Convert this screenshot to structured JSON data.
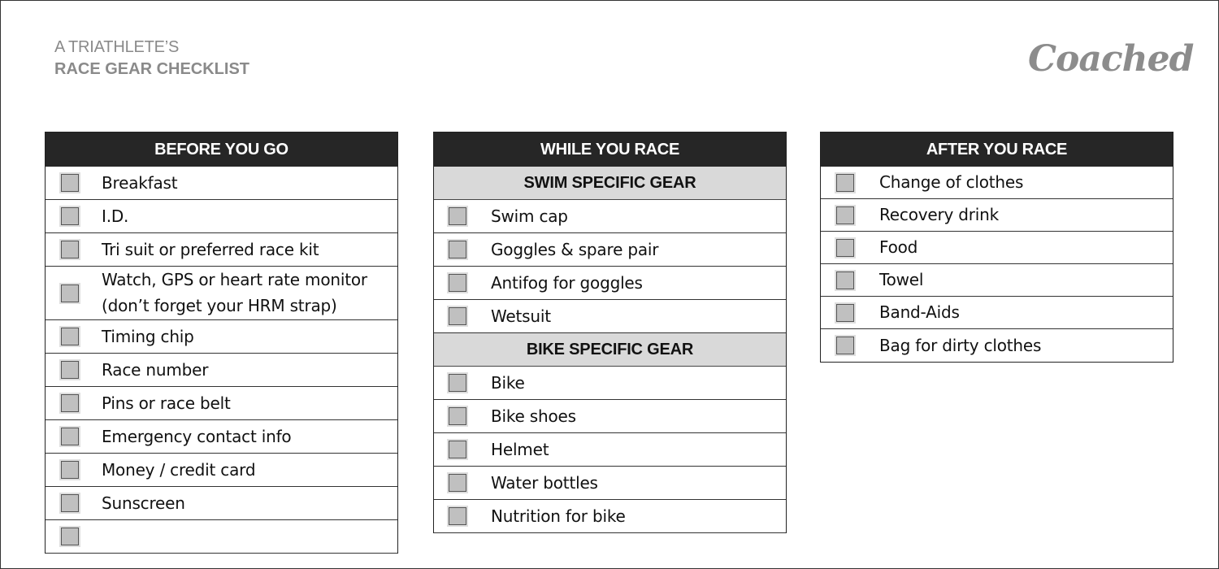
{
  "header": {
    "subtitle": "A TRIATHLETE’S",
    "title": "RACE GEAR CHECKLIST",
    "brand": "Coached"
  },
  "columns": [
    {
      "title": "BEFORE YOU GO",
      "items": [
        {
          "label": "Breakfast",
          "checked": false
        },
        {
          "label": "I.D.",
          "checked": false
        },
        {
          "label": "Tri suit or preferred race kit",
          "checked": false
        },
        {
          "label": "Watch, GPS or heart rate monitor",
          "label_line2": "(don’t forget your HRM strap)",
          "checked": false
        },
        {
          "label": "Timing chip",
          "checked": false
        },
        {
          "label": "Race number",
          "checked": false
        },
        {
          "label": "Pins or race belt",
          "checked": false
        },
        {
          "label": "Emergency contact info",
          "checked": false
        },
        {
          "label": "Money / credit card",
          "checked": false
        },
        {
          "label": "Sunscreen",
          "checked": false
        }
      ]
    },
    {
      "title": "WHILE YOU RACE",
      "sections": [
        {
          "title": "SWIM SPECIFIC GEAR",
          "items": [
            {
              "label": "Swim cap",
              "checked": false
            },
            {
              "label": "Goggles & spare pair",
              "checked": false
            },
            {
              "label": "Antifog for goggles",
              "checked": false
            },
            {
              "label": "Wetsuit",
              "checked": false
            }
          ]
        },
        {
          "title": "BIKE SPECIFIC GEAR",
          "items": [
            {
              "label": "Bike",
              "checked": false
            },
            {
              "label": "Bike shoes",
              "checked": false
            },
            {
              "label": "Helmet",
              "checked": false
            },
            {
              "label": "Water bottles",
              "checked": false
            },
            {
              "label": "Nutrition for bike",
              "checked": false
            }
          ]
        }
      ]
    },
    {
      "title": "AFTER YOU RACE",
      "items": [
        {
          "label": "Change of clothes",
          "checked": false
        },
        {
          "label": "Recovery drink",
          "checked": false
        },
        {
          "label": "Food",
          "checked": false
        },
        {
          "label": "Towel",
          "checked": false
        },
        {
          "label": "Band-Aids",
          "checked": false
        },
        {
          "label": "Bag for dirty clothes",
          "checked": false
        }
      ]
    }
  ]
}
